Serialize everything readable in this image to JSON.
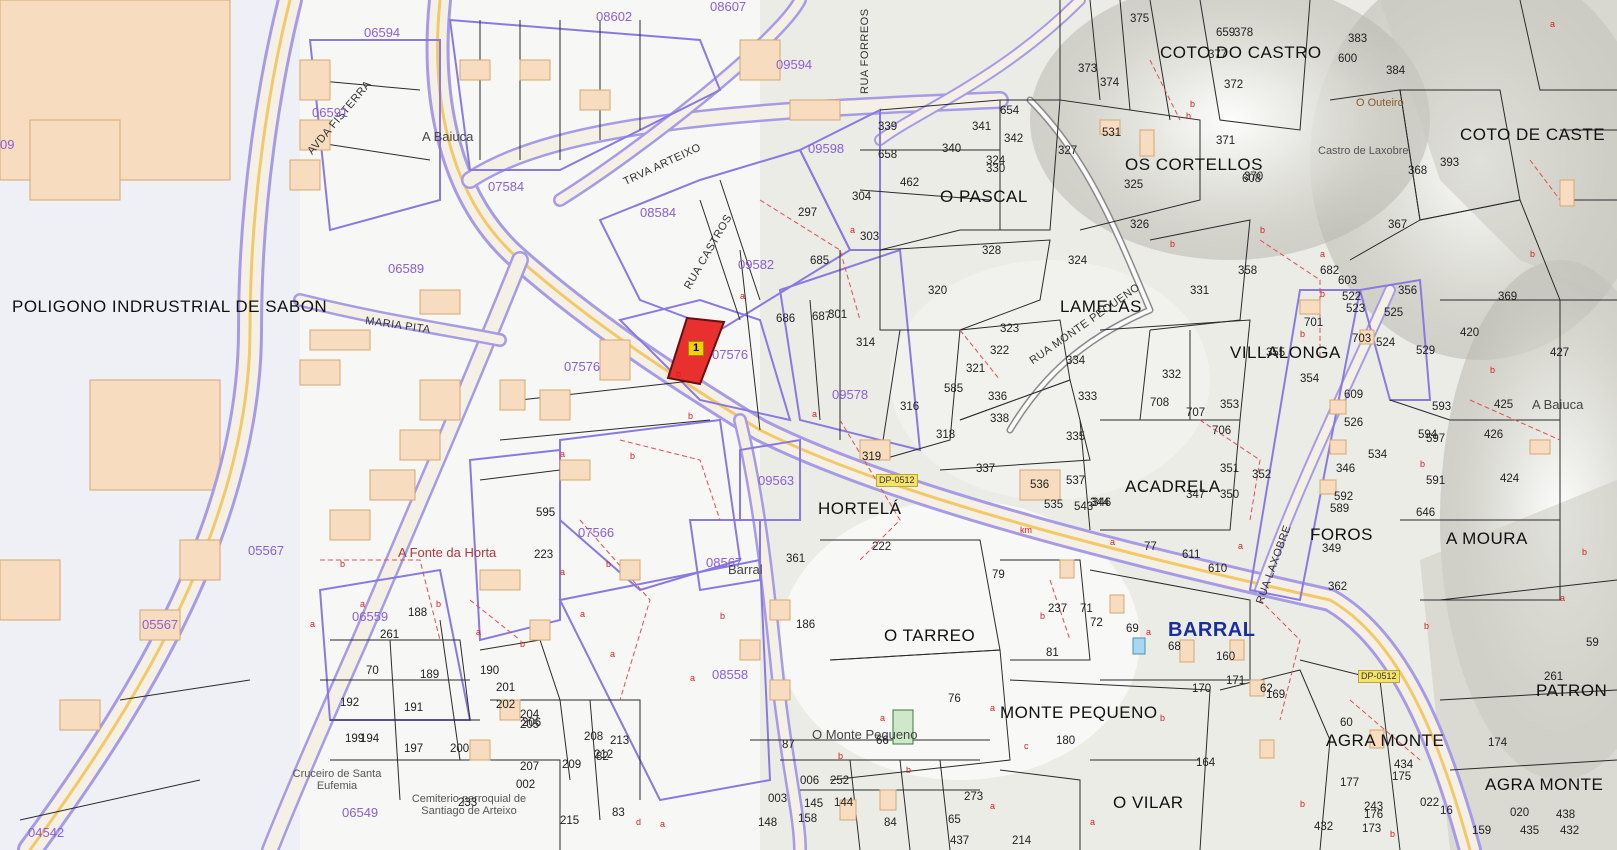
{
  "map": {
    "place_labels": [
      "POLIGONO INDRUSTRIAL DE SABON",
      "COTO DO CASTRO",
      "COTO DE CASTE",
      "OS CORTELLOS",
      "O PASCAL",
      "LAMELAS",
      "VILLALONGA",
      "HORTELÁ",
      "ACADRELA",
      "FOROS",
      "A MOURA",
      "O TARREO",
      "MONTE PEQUENO",
      "AGRA MONTE",
      "AGRA MONTE",
      "O VILAR",
      "PATRON"
    ],
    "main_locality": "BARRAL",
    "hamlets": [
      "A Baiuca",
      "A Baiuca",
      "A Fonte da Horta",
      "Barral",
      "O Monte Pequeno"
    ],
    "toponyms": [
      "O Outeiro",
      "Castro de Laxobre"
    ],
    "monuments": [
      "Cruceiro de Santa Eufemia",
      "Cemiterio parroquial de Santiago de Arteixo"
    ],
    "streets": [
      "AVDA FISTERRA",
      "TRVA ARTEIXO",
      "RUA CASTROS",
      "MARIA PITA",
      "RUA MONTE PEQUENO",
      "RUA LAXOBRE",
      "RUA FORREOS"
    ],
    "road_tags": [
      "DP-0512",
      "DP-0512"
    ],
    "selected_parcel_marker": "1",
    "sector_codes": [
      "06594",
      "08602",
      "08607",
      "09594",
      "06591",
      "07584",
      "09598",
      "08584",
      "06589",
      "09582",
      "07576",
      "07576",
      "09578",
      "09563",
      "07566",
      "08567",
      "05567",
      "06559",
      "05567",
      "08558",
      "06549",
      "04542",
      "09"
    ],
    "parcels": [
      "375",
      "378",
      "383",
      "659",
      "377",
      "372",
      "600",
      "384",
      "373",
      "374",
      "371",
      "608",
      "370",
      "368",
      "393",
      "531",
      "339",
      "341",
      "654",
      "342",
      "658",
      "340",
      "324",
      "330",
      "462",
      "327",
      "325",
      "304",
      "297",
      "326",
      "367",
      "685",
      "303",
      "328",
      "324",
      "320",
      "331",
      "358",
      "682",
      "603",
      "356",
      "369",
      "686",
      "687",
      "301",
      "314",
      "323",
      "322",
      "321",
      "334",
      "701",
      "703",
      "523",
      "522",
      "525",
      "524",
      "529",
      "427",
      "420",
      "355",
      "354",
      "353",
      "332",
      "333",
      "585",
      "336",
      "338",
      "316",
      "708",
      "707",
      "706",
      "352",
      "609",
      "593",
      "426",
      "425",
      "318",
      "335",
      "337",
      "351",
      "347",
      "350",
      "594",
      "526",
      "534",
      "597",
      "424",
      "319",
      "536",
      "537",
      "535",
      "543",
      "344",
      "346",
      "346",
      "591",
      "646",
      "592",
      "589",
      "595",
      "223",
      "222",
      "77",
      "611",
      "610",
      "349",
      "362",
      "361",
      "79",
      "237",
      "71",
      "72",
      "69",
      "68",
      "160",
      "59",
      "261",
      "188",
      "186",
      "81",
      "70",
      "189",
      "190",
      "201",
      "202",
      "204",
      "205",
      "206",
      "76",
      "171",
      "62",
      "169",
      "170",
      "261",
      "192",
      "191",
      "199",
      "194",
      "197",
      "200",
      "207",
      "209",
      "212",
      "208",
      "213",
      "82",
      "87",
      "66",
      "180",
      "60",
      "434",
      "174",
      "175",
      "177",
      "176",
      "243",
      "173",
      "164",
      "432",
      "020",
      "022",
      "233",
      "002",
      "003",
      "006",
      "252",
      "145",
      "144",
      "148",
      "158",
      "84",
      "65",
      "273",
      "214",
      "215",
      "83",
      "437",
      "435",
      "438",
      "432",
      "159",
      "16"
    ],
    "small_labels": [
      "a",
      "b",
      "c",
      "d",
      "km"
    ],
    "colors": {
      "background": "#f7f7f5",
      "sector_line": "#8a7ae0",
      "parcel_line": "#2a2a2a",
      "sub_parcel_line": "#e05050",
      "building_fill": "#f7dcc0",
      "building_outline": "#d4a870",
      "selected_parcel_fill": "#e8312f",
      "selected_parcel_outline": "#6a0f10",
      "road_fill": "#f5f0e6",
      "road_casing": "#a79be6",
      "road_center": "#f2c96a",
      "relief_shade": "#b8b8b0",
      "place_label": "#111111",
      "main_locality_label": "#1b2d9a",
      "sector_label": "#8a5fd6"
    }
  }
}
